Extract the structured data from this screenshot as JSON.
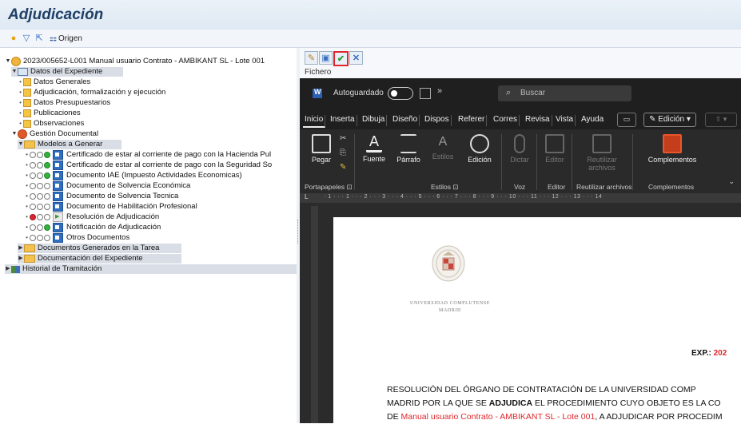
{
  "app": {
    "title": "Adjudicación"
  },
  "toolbar": {
    "origin_label": "Origen"
  },
  "tree": {
    "root": "2023/005652-L001 Manual usuario Contrato - AMBIKANT SL - Lote 001",
    "datos_expediente": "Datos del Expediente",
    "datos_items": [
      "Datos Generales",
      "Adjudicación, formalización y ejecución",
      "Datos Presupuestarios",
      "Publicaciones",
      "Observaciones"
    ],
    "gestion_documental": "Gestión Documental",
    "modelos": "Modelos a Generar",
    "modelos_items": [
      "Certificado de estar al corriente de pago con la Hacienda Pul",
      "Certificado de estar al corriente de pago con la Seguridad So",
      "Documento IAE (Impuesto Actividades Economicas)",
      "Documento de Solvencia Económica",
      "Documento de Solvencia Tecnica",
      "Documento de Habilitación Profesional",
      "Resolución de Adjudicación",
      "Notificación de Adjudicación",
      "Otros Documentos"
    ],
    "docs_tarea": "Documentos Generados en la Tarea",
    "doc_expediente": "Documentación del Expediente",
    "historial": "Historial de Tramitación"
  },
  "editor_toolbar": {
    "fichero": "Fichero"
  },
  "word": {
    "autosave": "Autoguardado",
    "search": "Buscar",
    "more": "»",
    "tabs": [
      "Inicio",
      "Inserta",
      "Dibuja",
      "Diseño",
      "Dispos",
      "Referer",
      "Corres",
      "Revisa",
      "Vista",
      "Ayuda"
    ],
    "edit_mode": "Edición",
    "ribbon": {
      "pegar": "Pegar",
      "fuente": "Fuente",
      "parrafo": "Párrafo",
      "estilos": "Estilos",
      "edicion": "Edición",
      "dictar": "Dictar",
      "editor": "Editor",
      "reutilizar": "Reutilizar archivos",
      "complementos": "Complementos"
    },
    "groups": {
      "portapapeles": "Portapapeles",
      "estilos": "Estilos",
      "voz": "Voz",
      "editor": "Editor",
      "reutilizar": "Reutilizar archivos",
      "complementos": "Complementos"
    },
    "ruler": "· 1 · · · 1 · · · 2 · · · 3 · · · 4 · · · 5 · · · 6 · · · 7 · · · 8 · · · 9 · · · 10 · · · 11 · · · 12 · · · 13 · · · 14"
  },
  "document": {
    "uni_line1": "UNIVERSIDAD COMPLUTENSE",
    "uni_line2": "MADRID",
    "exp_label": "EXP.: ",
    "exp_value": "202",
    "line1": "RESOLUCIÓN DEL ÓRGANO DE CONTRATACIÓN DE LA UNIVERSIDAD COMP",
    "line2_a": "MADRID POR LA QUE SE ",
    "line2_b": "ADJUDICA",
    "line2_c": " EL PROCEDIMIENTO CUYO OBJETO ES LA CO",
    "line3_a": "DE ",
    "line3_b": "Manual usuario Contrato - AMBIKANT SL - Lote 001",
    "line3_c": ", A ADJUDICAR POR PROCEDIM"
  },
  "colors": {
    "accent_red": "#e0262b",
    "header_blue": "#1f3f66",
    "word_dark": "#2b2b2b"
  }
}
